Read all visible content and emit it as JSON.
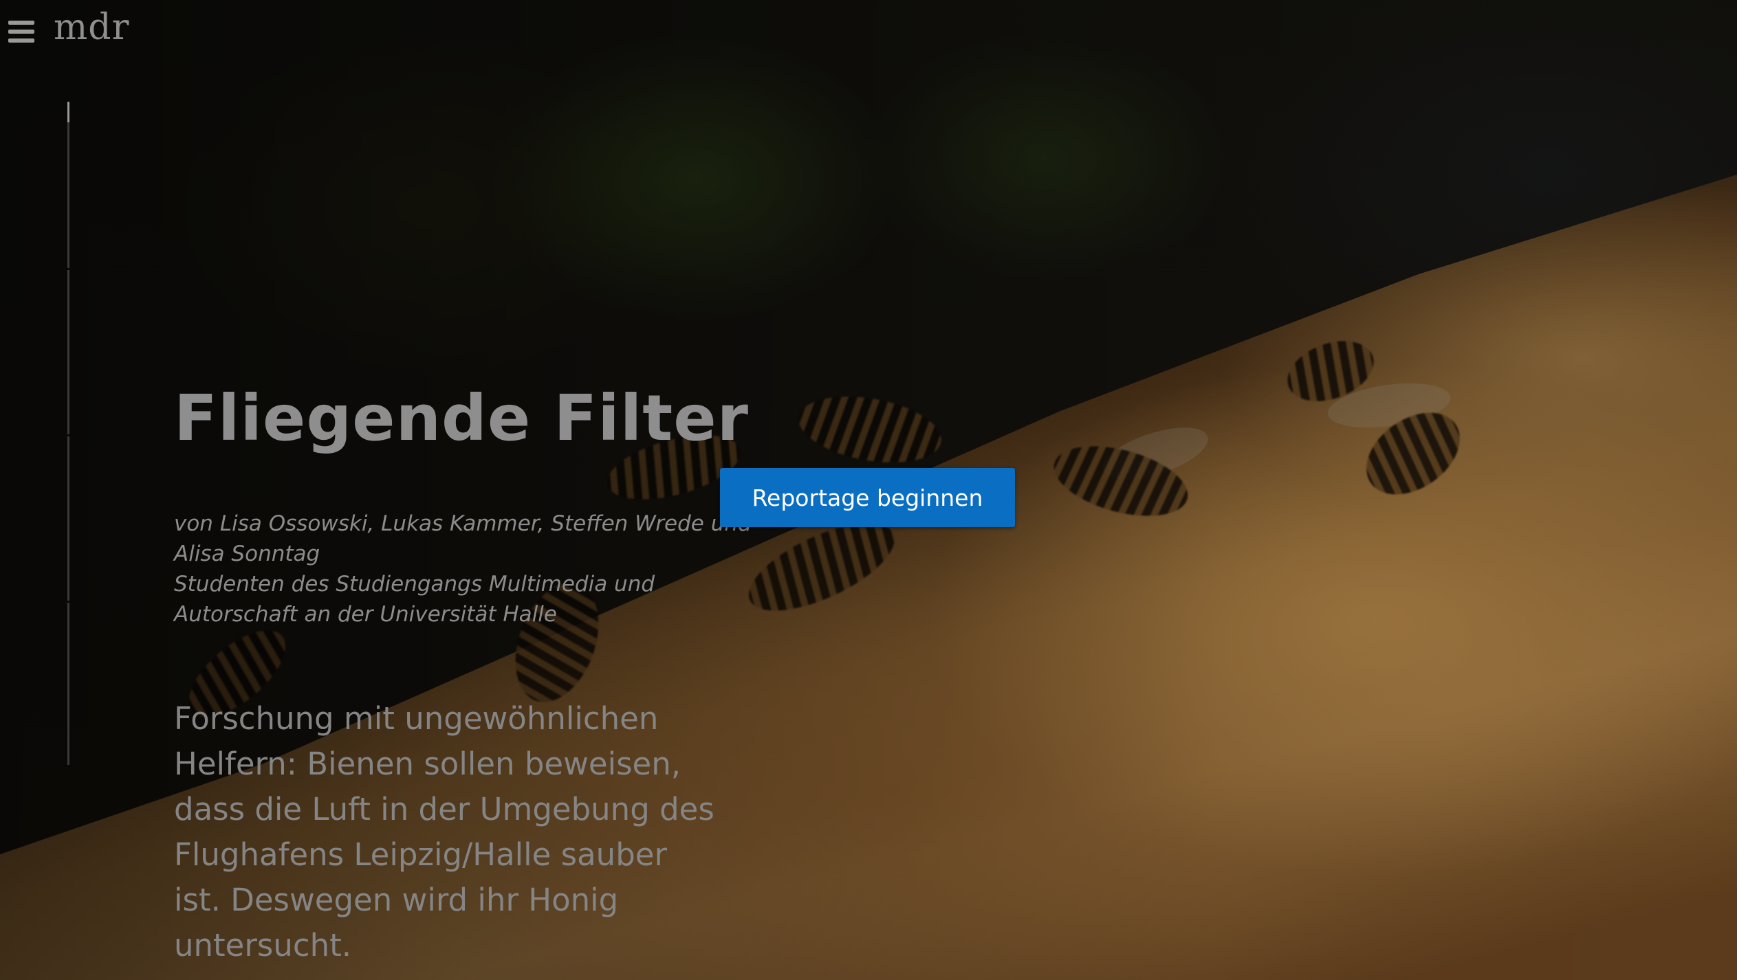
{
  "header": {
    "menu_icon": "hamburger-menu-icon",
    "logo_text": "mdr"
  },
  "hero": {
    "title": "Fliegende Filter",
    "byline": [
      "von Lisa Ossowski, Lukas Kammer, Steffen Wrede und",
      "Alisa Sonntag",
      "Studenten des Studiengangs Multimedia und",
      "Autorschaft an der Universität Halle"
    ],
    "lead": [
      "Forschung mit ungewöhnlichen",
      "Helfern: Bienen sollen beweisen,",
      "dass die Luft in der Umgebung des",
      "Flughafens Leipzig/Halle sauber",
      "ist. Deswegen wird ihr Honig",
      "untersucht."
    ],
    "cta_label": "Reportage beginnen"
  },
  "progress": {
    "chapters": 4,
    "current_chapter": 1
  },
  "colors": {
    "accent": "#0a6ec2",
    "text_muted": "#8e8e8e"
  }
}
